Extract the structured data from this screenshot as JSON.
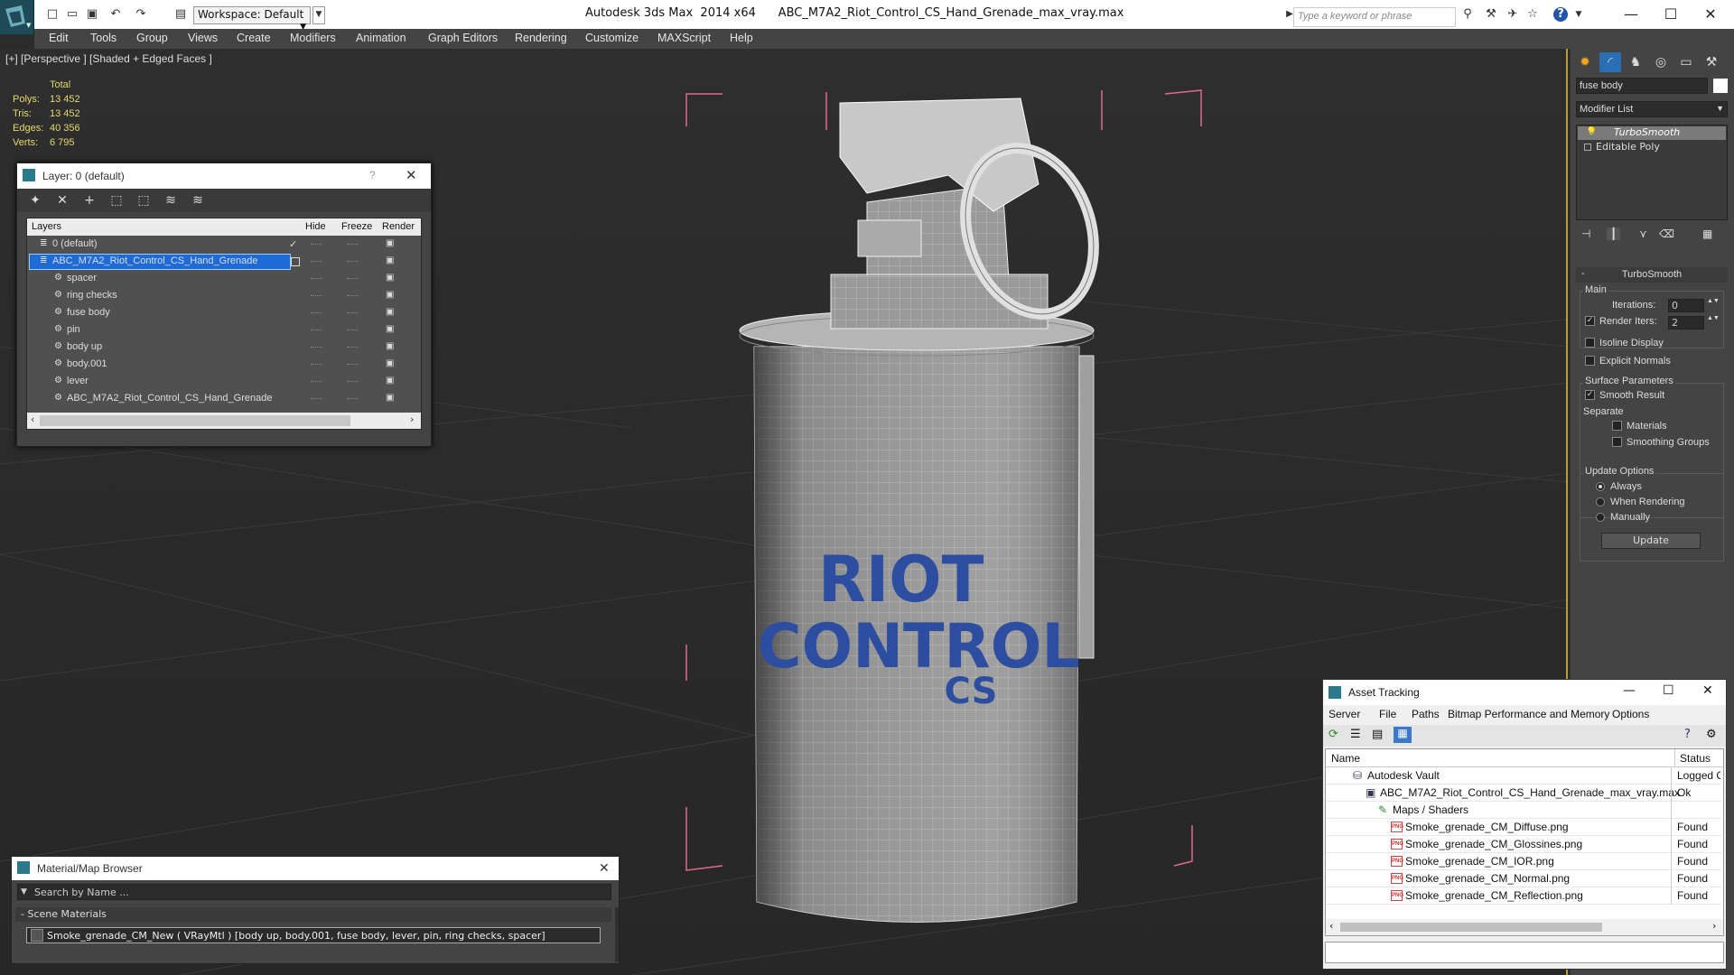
{
  "app": {
    "workspace": "Workspace: Default",
    "title": "Autodesk 3ds Max  2014 x64      ABC_M7A2_Riot_Control_CS_Hand_Grenade_max_vray.max",
    "search_placeholder": "Type a keyword or phrase"
  },
  "menu": [
    "Edit",
    "Tools",
    "Group",
    "Views",
    "Create",
    "Modifiers",
    "Animation",
    "Graph Editors",
    "Rendering",
    "Customize",
    "MAXScript",
    "Help"
  ],
  "viewport": {
    "label": "[+] [Perspective ] [Shaded + Edged Faces ]",
    "stats": {
      "header": "Total",
      "rows": [
        {
          "label": "Polys:",
          "value": "13 452"
        },
        {
          "label": "Tris:",
          "value": "13 452"
        },
        {
          "label": "Edges:",
          "value": "40 356"
        },
        {
          "label": "Verts:",
          "value": "6 795"
        }
      ]
    },
    "model_text": [
      "RIOT",
      "CONTROL",
      "CS"
    ]
  },
  "layer_dialog": {
    "title": "Layer: 0 (default)",
    "help": "?",
    "columns": [
      "Layers",
      "Hide",
      "Freeze",
      "Render"
    ],
    "rows": [
      {
        "name": "0 (default)",
        "type": "layer"
      },
      {
        "name": "ABC_M7A2_Riot_Control_CS_Hand_Grenade",
        "type": "layer"
      },
      {
        "name": "spacer",
        "type": "object"
      },
      {
        "name": "ring checks",
        "type": "object"
      },
      {
        "name": "fuse body",
        "type": "object"
      },
      {
        "name": "pin",
        "type": "object"
      },
      {
        "name": "body up",
        "type": "object"
      },
      {
        "name": "body.001",
        "type": "object"
      },
      {
        "name": "lever",
        "type": "object"
      },
      {
        "name": "ABC_M7A2_Riot_Control_CS_Hand_Grenade",
        "type": "object"
      }
    ]
  },
  "material_browser": {
    "title": "Material/Map Browser",
    "search_placeholder": "Search by Name ...",
    "section": "- Scene Materials",
    "item": "Smoke_grenade_CM_New  ( VRayMtl ) [body up, body.001, fuse body, lever, pin, ring checks, spacer]"
  },
  "command_panel": {
    "object_name": "fuse body",
    "modifier_list": "Modifier List",
    "stack": [
      "TurboSmooth",
      "Editable Poly"
    ],
    "rollout_title": "TurboSmooth",
    "main_group": "Main",
    "iterations_label": "Iterations:",
    "iterations_value": "0",
    "render_iters_label": "Render Iters:",
    "render_iters_value": "2",
    "isoline": "Isoline Display",
    "explicit": "Explicit Normals",
    "surface_group": "Surface Parameters",
    "smooth_result": "Smooth Result",
    "separate": "Separate",
    "materials": "Materials",
    "smoothing_groups": "Smoothing Groups",
    "update_group": "Update Options",
    "always": "Always",
    "when_rendering": "When Rendering",
    "manually": "Manually",
    "update_button": "Update"
  },
  "asset_tracking": {
    "title": "Asset Tracking",
    "menu": [
      "Server",
      "File",
      "Paths",
      "Bitmap Performance and Memory",
      "Options"
    ],
    "col_name": "Name",
    "col_status": "Status",
    "rows": [
      {
        "name": "Autodesk Vault",
        "status": "Logged O"
      },
      {
        "name": "ABC_M7A2_Riot_Control_CS_Hand_Grenade_max_vray.max",
        "status": "Ok"
      },
      {
        "name": "Maps / Shaders",
        "status": ""
      },
      {
        "name": "Smoke_grenade_CM_Diffuse.png",
        "status": "Found"
      },
      {
        "name": "Smoke_grenade_CM_Glossines.png",
        "status": "Found"
      },
      {
        "name": "Smoke_grenade_CM_IOR.png",
        "status": "Found"
      },
      {
        "name": "Smoke_grenade_CM_Normal.png",
        "status": "Found"
      },
      {
        "name": "Smoke_grenade_CM_Reflection.png",
        "status": "Found"
      }
    ]
  },
  "colors": {
    "accent": "#1e6ad6",
    "viewport_border": "#b69d3b",
    "stats": "#e7d96a",
    "model_text": "#2d4ea0"
  }
}
